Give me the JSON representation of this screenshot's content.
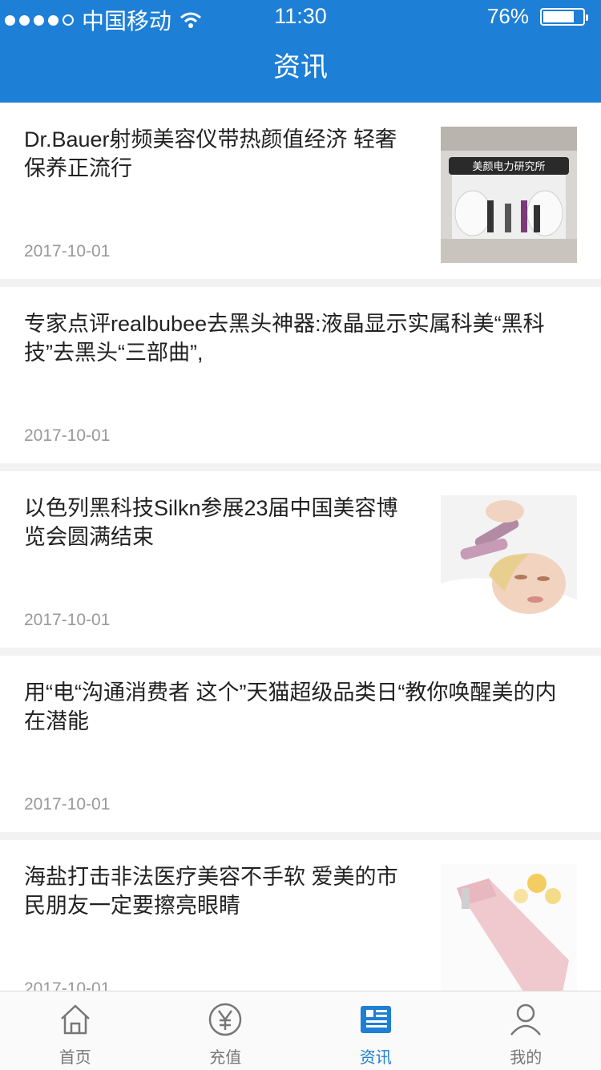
{
  "status_bar": {
    "carrier": "中国移动",
    "time": "11:30",
    "battery": "76%"
  },
  "header": {
    "title": "资讯"
  },
  "news": [
    {
      "title": "Dr.Bauer射频美容仪带热颜值经济 轻奢保养正流行",
      "date": "2017-10-01",
      "has_thumb": true,
      "thumb_sign": "美颜电力研究所"
    },
    {
      "title": "专家点评realbubee去黑头神器:液晶显示实属科美“黑科技”去黑头“三部曲”,",
      "date": "2017-10-01",
      "has_thumb": false
    },
    {
      "title": "以色列黑科技Silkn参展23届中国美容博览会圆满结束",
      "date": "2017-10-01",
      "has_thumb": true
    },
    {
      "title": "用“电“沟通消费者 这个”天猫超级品类日“教你唤醒美的内在潜能",
      "date": "2017-10-01",
      "has_thumb": false
    },
    {
      "title": "海盐打击非法医疗美容不手软 爱美的市民朋友一定要擦亮眼睛",
      "date": "2017-10-01",
      "has_thumb": true
    }
  ],
  "tabs": [
    {
      "label": "首页",
      "icon": "home-icon",
      "active": false
    },
    {
      "label": "充值",
      "icon": "yen-icon",
      "active": false
    },
    {
      "label": "资讯",
      "icon": "news-icon",
      "active": true
    },
    {
      "label": "我的",
      "icon": "user-icon",
      "active": false
    }
  ],
  "colors": {
    "brand": "#1e7fd6",
    "text": "#222222",
    "muted": "#999999"
  }
}
